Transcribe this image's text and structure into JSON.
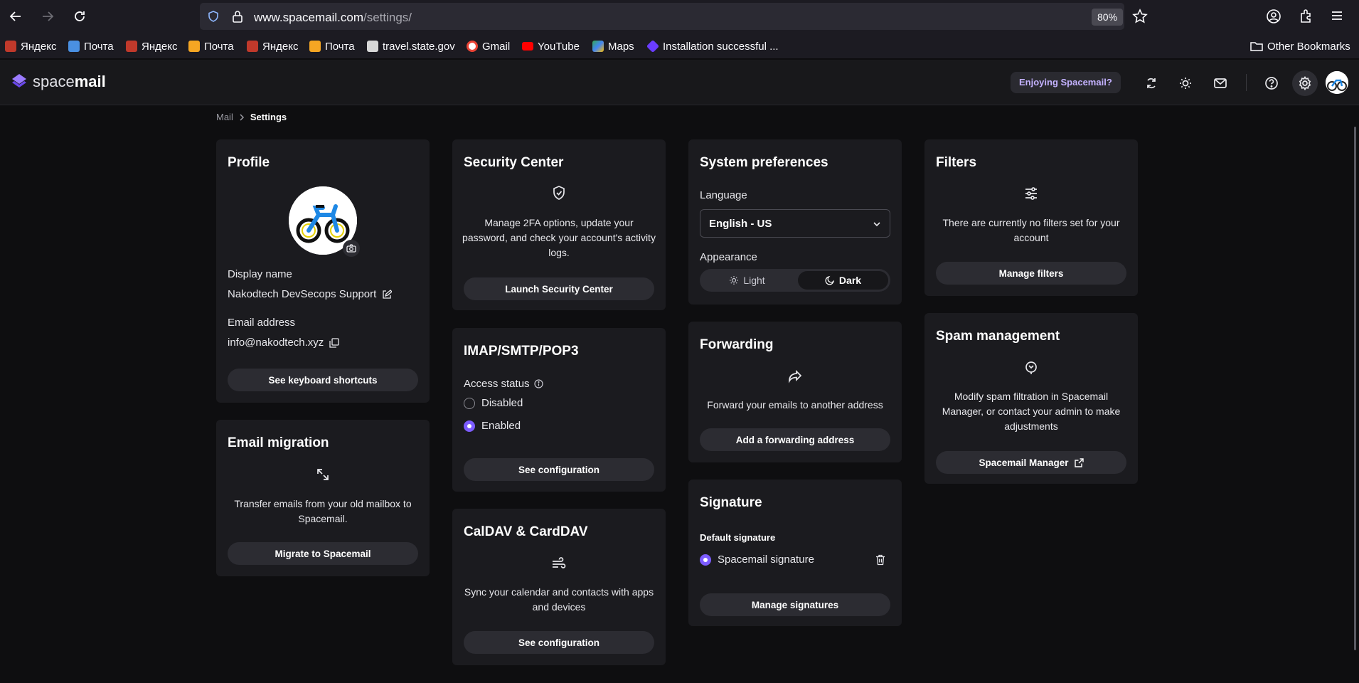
{
  "browser": {
    "url_host": "www.spacemail.com",
    "url_path": "/settings/",
    "zoom": "80%",
    "bookmarks": [
      {
        "label": "Яндекс",
        "color": "#e01f1f"
      },
      {
        "label": "Почта",
        "color": "#4a90e2"
      },
      {
        "label": "Яндекс",
        "color": "#e01f1f"
      },
      {
        "label": "Почта",
        "color": "#f5a623"
      },
      {
        "label": "Яндекс",
        "color": "#e01f1f"
      },
      {
        "label": "Почта",
        "color": "#f5a623"
      },
      {
        "label": "travel.state.gov",
        "color": "#dddddd"
      },
      {
        "label": "Gmail",
        "color": "#ea4335"
      },
      {
        "label": "YouTube",
        "color": "#ff0000"
      },
      {
        "label": "Maps",
        "color": "#34a853"
      },
      {
        "label": "Installation successful ...",
        "color": "#6a3cff"
      }
    ],
    "other_bookmarks": "Other Bookmarks"
  },
  "app": {
    "logo_light": "space",
    "logo_bold": "mail",
    "enjoy_label": "Enjoying Spacemail?",
    "accent": "#7c5cff"
  },
  "breadcrumb": {
    "parent": "Mail",
    "current": "Settings"
  },
  "profile": {
    "title": "Profile",
    "display_name_label": "Display name",
    "display_name": "Nakodtech DevSecops Support",
    "email_label": "Email address",
    "email": "info@nakodtech.xyz",
    "shortcuts_btn": "See keyboard shortcuts"
  },
  "migration": {
    "title": "Email migration",
    "desc": "Transfer emails from your old mailbox to Spacemail.",
    "btn": "Migrate to Spacemail"
  },
  "security": {
    "title": "Security Center",
    "desc": "Manage 2FA options, update your password, and check your account's activity logs.",
    "btn": "Launch Security Center"
  },
  "imap": {
    "title": "IMAP/SMTP/POP3",
    "access_label": "Access status",
    "opt_disabled": "Disabled",
    "opt_enabled": "Enabled",
    "selected": "Enabled",
    "btn": "See configuration"
  },
  "caldav": {
    "title": "CalDAV & CardDAV",
    "desc": "Sync your calendar and contacts with apps and devices",
    "btn": "See configuration"
  },
  "system": {
    "title": "System preferences",
    "language_label": "Language",
    "language_value": "English - US",
    "appearance_label": "Appearance",
    "light_label": "Light",
    "dark_label": "Dark",
    "selected_theme": "Dark"
  },
  "forwarding": {
    "title": "Forwarding",
    "desc": "Forward your emails to another address",
    "btn": "Add a forwarding address"
  },
  "signature": {
    "title": "Signature",
    "default_label": "Default signature",
    "item": "Spacemail signature",
    "btn": "Manage signatures"
  },
  "filters": {
    "title": "Filters",
    "desc": "There are currently no filters set for your account",
    "btn": "Manage filters"
  },
  "spam": {
    "title": "Spam management",
    "desc": "Modify spam filtration in Spacemail Manager, or contact your admin to make adjustments",
    "btn": "Spacemail Manager"
  }
}
